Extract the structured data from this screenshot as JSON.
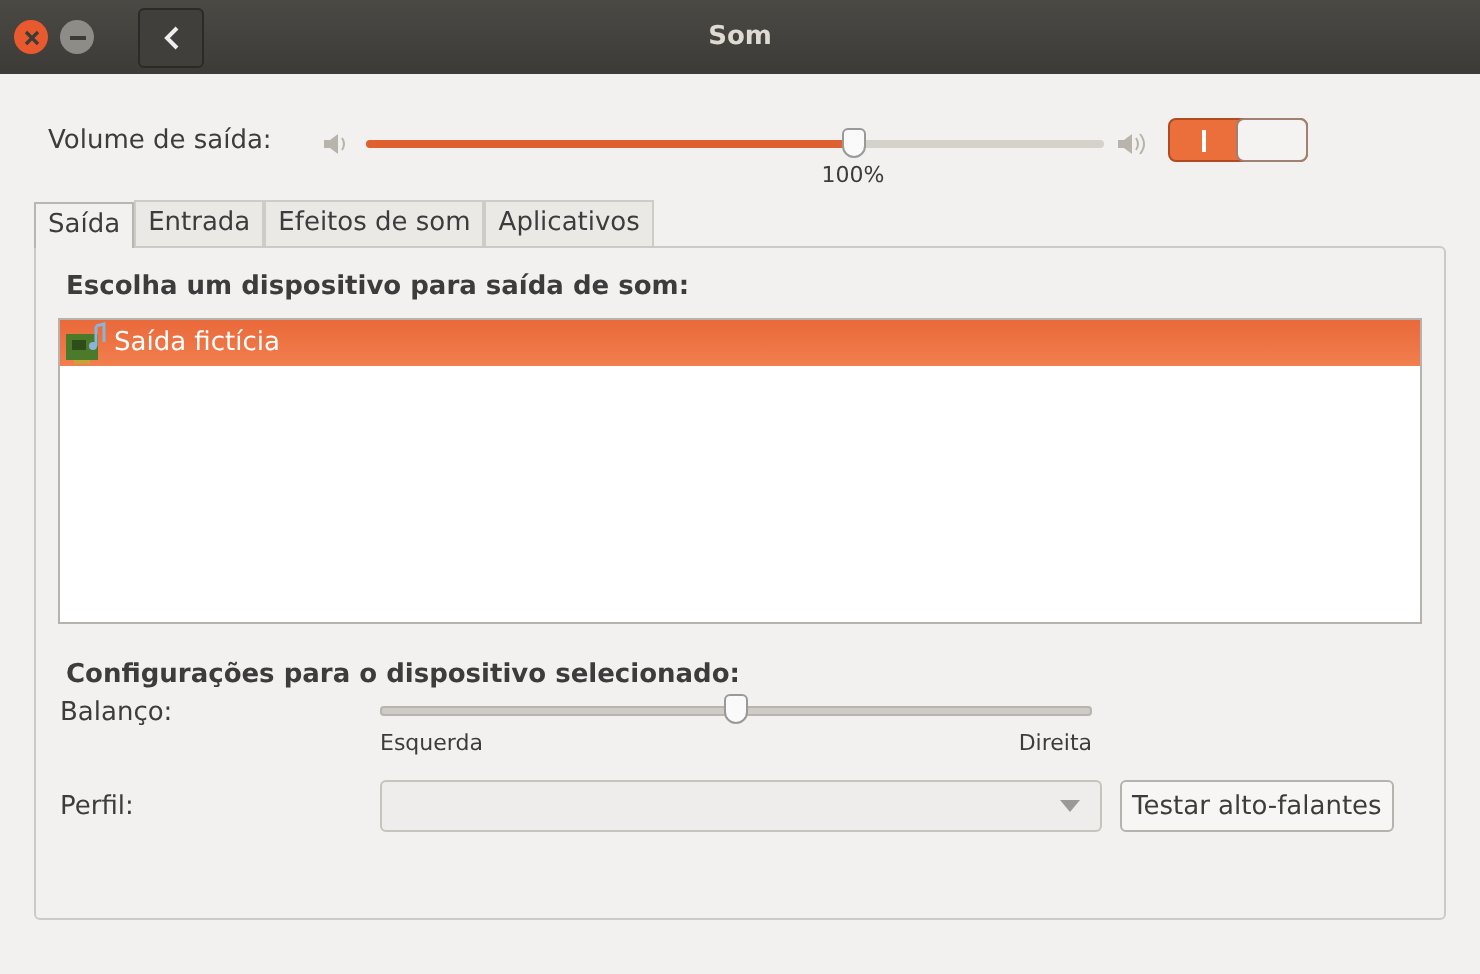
{
  "window": {
    "title": "Som"
  },
  "volume": {
    "label": "Volume de saída:",
    "level": 0.66,
    "reading": "100%",
    "switch_on": true
  },
  "tabs": [
    {
      "label": "Saída",
      "selected": true
    },
    {
      "label": "Entrada",
      "selected": false
    },
    {
      "label": "Efeitos de som",
      "selected": false
    },
    {
      "label": "Aplicativos",
      "selected": false
    }
  ],
  "device_heading": "Escolha um dispositivo para saída de som:",
  "devices": [
    {
      "name": "Saída fictícia",
      "selected": true
    }
  ],
  "settings_heading": "Configurações para o dispositivo selecionado:",
  "balance": {
    "label": "Balanço:",
    "level": 0.5,
    "left_label": "Esquerda",
    "right_label": "Direita"
  },
  "profile": {
    "label": "Perfil:",
    "disabled": true
  },
  "test_button": "Testar alto-falantes"
}
